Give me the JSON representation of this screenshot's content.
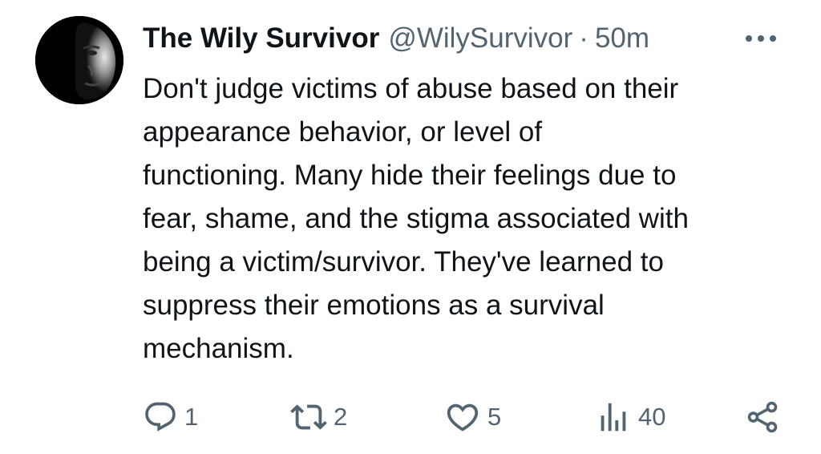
{
  "tweet": {
    "display_name": "The Wily Survivor",
    "handle": "@WilySurvivor",
    "separator": "·",
    "time": "50m",
    "text": "Don't judge victims of abuse based on their\nappearance behavior, or level of\nfunctioning. Many hide their feelings due to\nfear, shame, and the stigma associated with\nbeing a victim/survivor. They've learned to\nsuppress their emotions as a survival\nmechanism."
  },
  "actions": {
    "reply_count": "1",
    "retweet_count": "2",
    "like_count": "5",
    "views_count": "40"
  },
  "icons": {
    "more": "more-horizontal-icon",
    "reply": "reply-icon",
    "retweet": "retweet-icon",
    "like": "heart-icon",
    "views": "views-bar-chart-icon",
    "share": "share-icon"
  },
  "colors": {
    "text_primary": "#0f1419",
    "text_secondary": "#536471"
  }
}
